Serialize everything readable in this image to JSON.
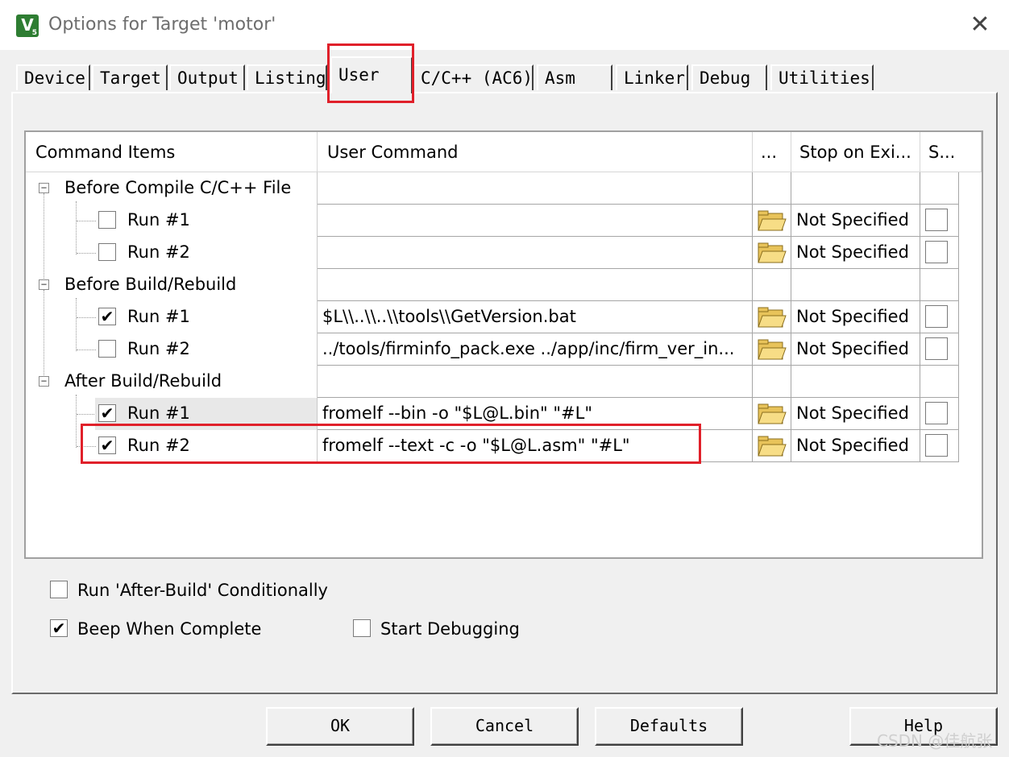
{
  "window": {
    "title": "Options for Target 'motor'",
    "close_glyph": "✕",
    "app_icon_letter": "V",
    "app_icon_sub": "5"
  },
  "tabs": [
    {
      "label": "Device"
    },
    {
      "label": "Target"
    },
    {
      "label": "Output"
    },
    {
      "label": "Listing"
    },
    {
      "label": "User",
      "active": true
    },
    {
      "label": "C/C++ (AC6)"
    },
    {
      "label": "Asm"
    },
    {
      "label": "Linker"
    },
    {
      "label": "Debug"
    },
    {
      "label": "Utilities"
    }
  ],
  "grid": {
    "headers": {
      "command_items": "Command Items",
      "user_command": "User Command",
      "browse": "...",
      "stop_on_exit": "Stop on Exi...",
      "s": "S..."
    },
    "groups": [
      {
        "label": "Before Compile C/C++ File",
        "runs": [
          {
            "label": "Run #1",
            "checked": false,
            "command": "",
            "stop": "Not Specified"
          },
          {
            "label": "Run #2",
            "checked": false,
            "command": "",
            "stop": "Not Specified"
          }
        ]
      },
      {
        "label": "Before Build/Rebuild",
        "runs": [
          {
            "label": "Run #1",
            "checked": true,
            "command": "$L\\\\..\\\\..\\\\tools\\\\GetVersion.bat",
            "stop": "Not Specified"
          },
          {
            "label": "Run #2",
            "checked": false,
            "command": "../tools/firminfo_pack.exe ../app/inc/firm_ver_in...",
            "stop": "Not Specified"
          }
        ]
      },
      {
        "label": "After Build/Rebuild",
        "runs": [
          {
            "label": "Run #1",
            "checked": true,
            "command": "fromelf --bin -o \"$L@L.bin\" \"#L\"",
            "stop": "Not Specified"
          },
          {
            "label": "Run #2",
            "checked": true,
            "command": "fromelf --text -c -o \"$L@L.asm\" \"#L\"",
            "stop": "Not Specified"
          }
        ]
      }
    ],
    "expander_glyph": "−",
    "check_glyph": "✔"
  },
  "options": {
    "run_after_build_conditionally": {
      "label": "Run 'After-Build' Conditionally",
      "checked": false
    },
    "beep_when_complete": {
      "label": "Beep When Complete",
      "checked": true
    },
    "start_debugging": {
      "label": "Start Debugging",
      "checked": false
    }
  },
  "buttons": {
    "ok": "OK",
    "cancel": "Cancel",
    "defaults": "Defaults",
    "help": "Help"
  },
  "watermark": "CSDN @佳航张",
  "colors": {
    "highlight_red": "#e0202a",
    "app_icon_green": "#2e7d32"
  }
}
